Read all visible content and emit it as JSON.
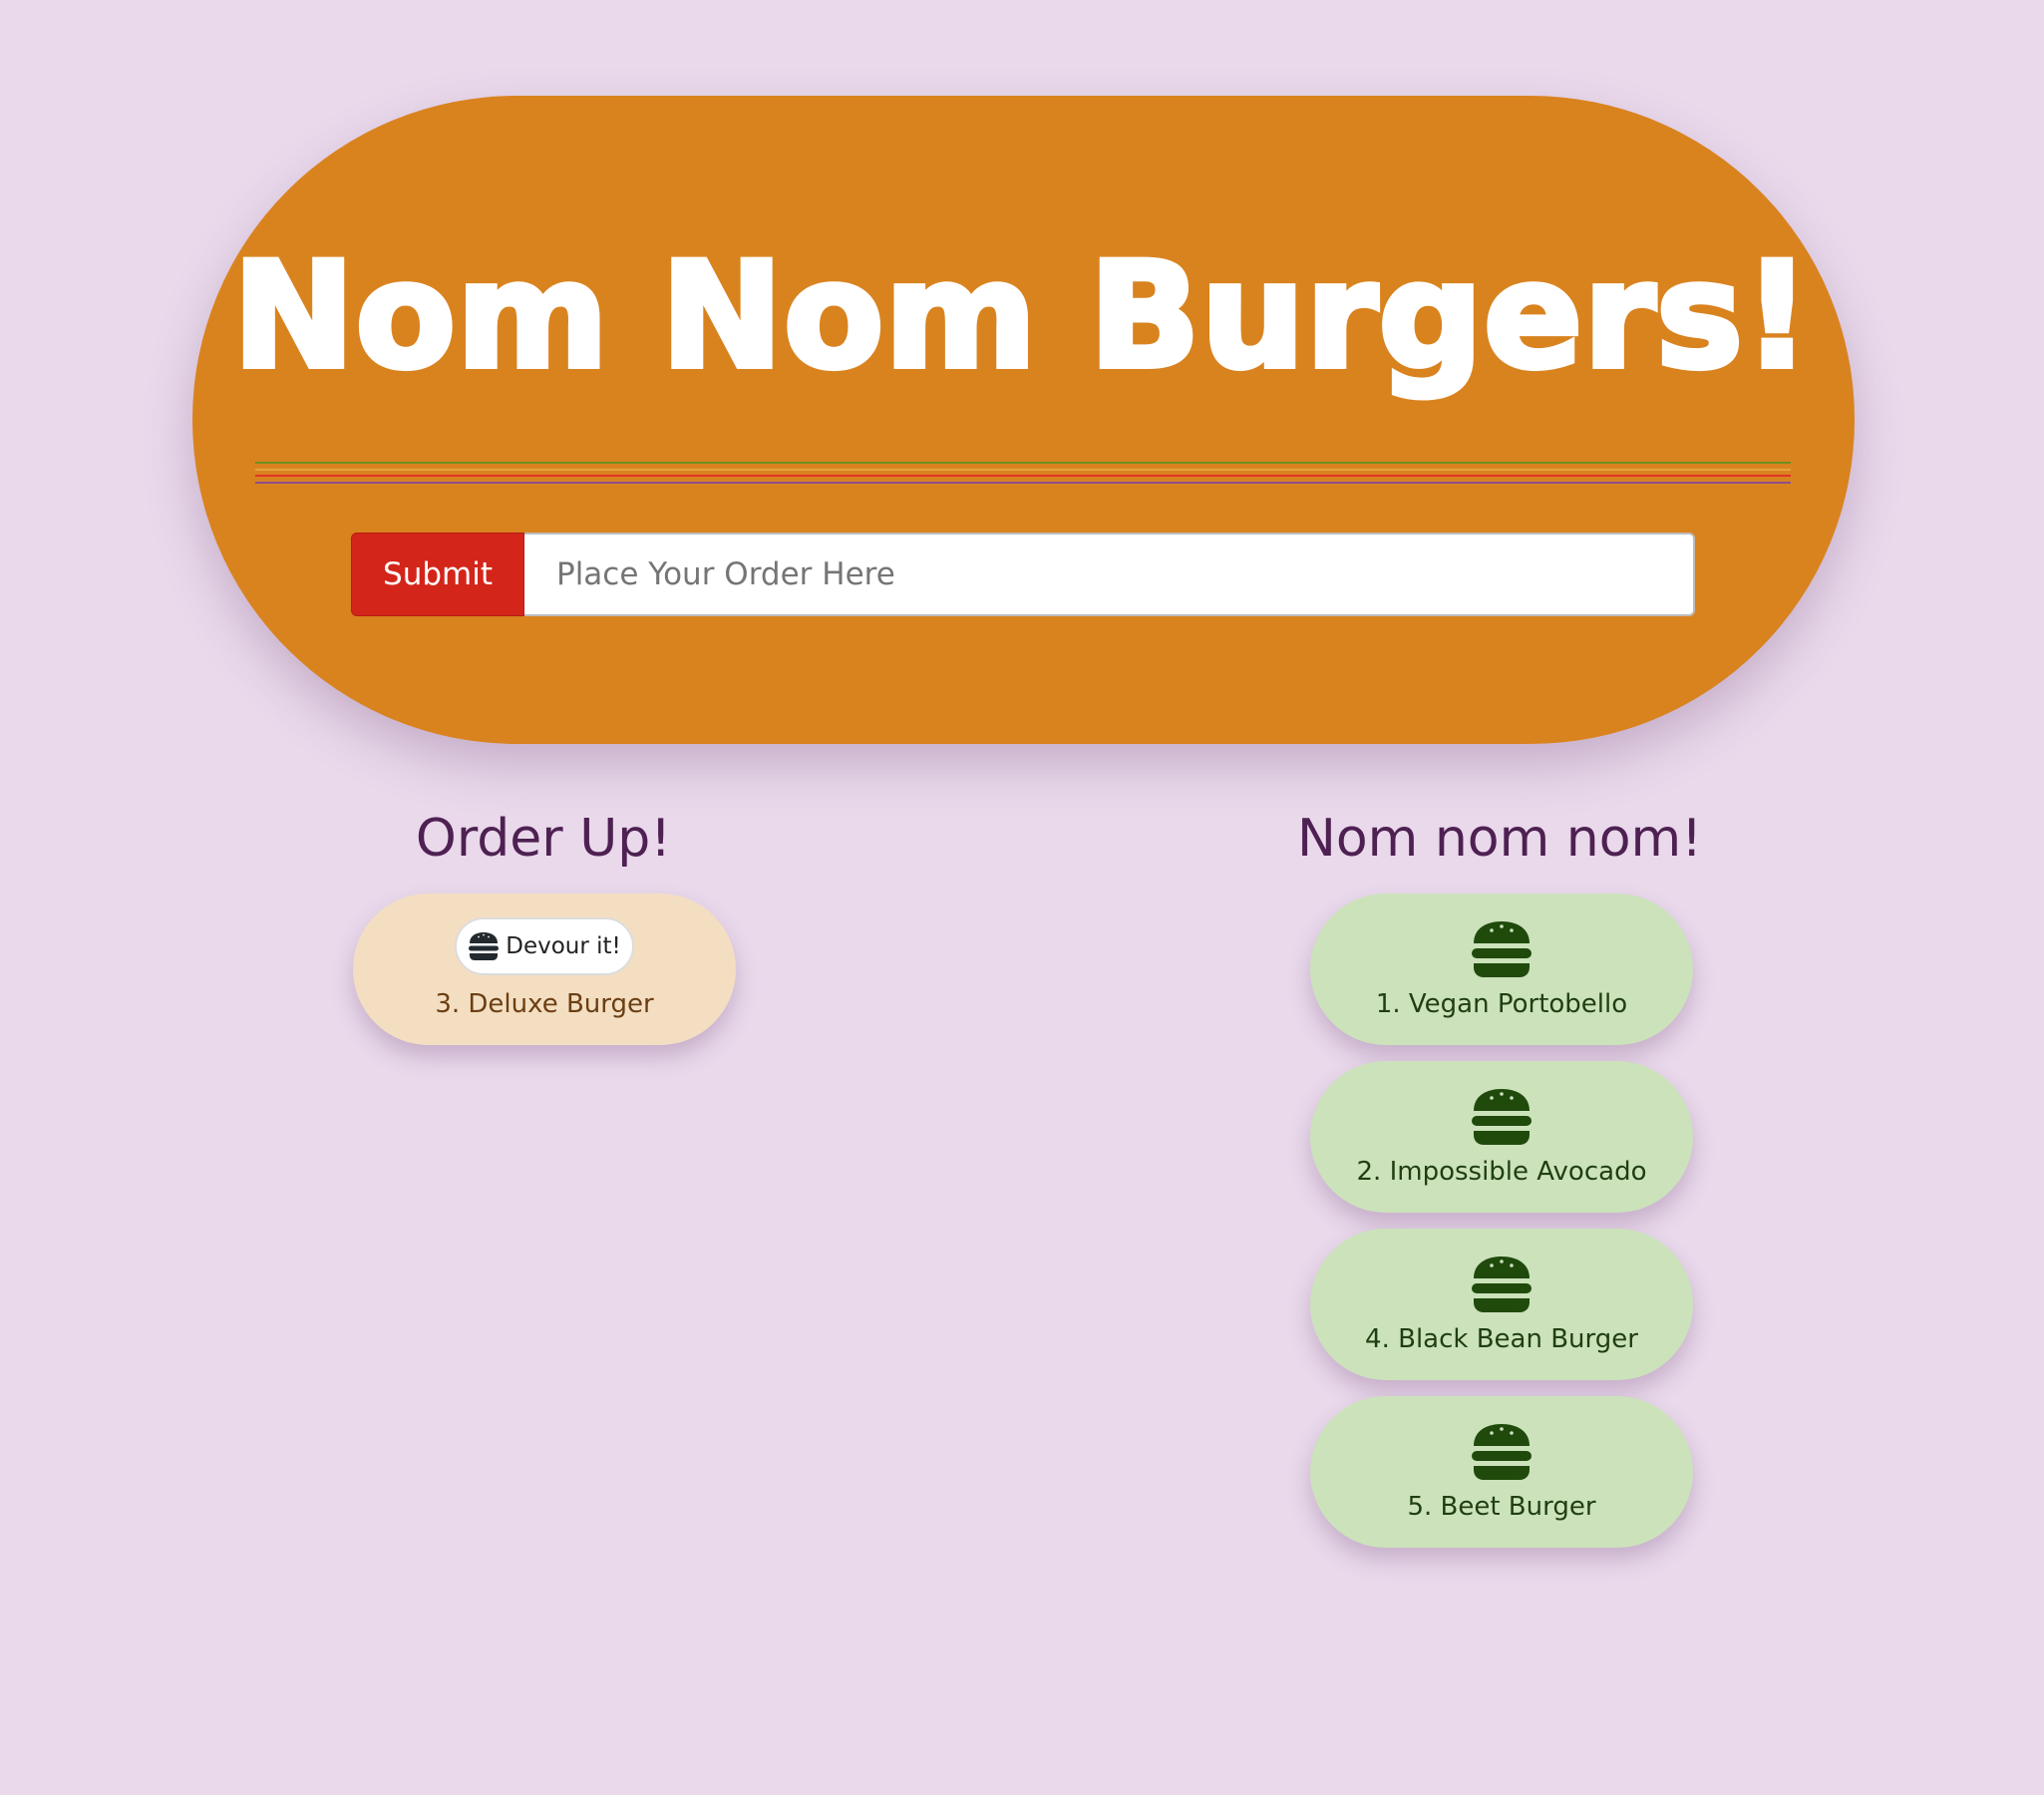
{
  "header": {
    "title": "Nom Nom Burgers!"
  },
  "order_form": {
    "submit_label": "Submit",
    "input_placeholder": "Place Your Order Here",
    "input_value": ""
  },
  "columns": {
    "waiting_title": "Order Up!",
    "devoured_title": "Nom nom nom!"
  },
  "waiting_burgers": [
    {
      "label": "3. Deluxe Burger",
      "button_label": "Devour it!",
      "icon": "burger-icon"
    }
  ],
  "devoured_burgers": [
    {
      "label": "1. Vegan Portobello",
      "icon": "burger-icon"
    },
    {
      "label": "2. Impossible Avocado",
      "icon": "burger-icon"
    },
    {
      "label": "4. Black Bean Burger",
      "icon": "burger-icon"
    },
    {
      "label": "5. Beet Burger",
      "icon": "burger-icon"
    }
  ],
  "colors": {
    "background": "#e9d9eb",
    "header": "#d9831f",
    "submit_button": "#d3251a",
    "waiting_card": "#f4dec2",
    "devoured_card": "#cce2bb",
    "column_title": "#4e2152",
    "stripe_1": "#6f8f1f",
    "stripe_2": "#e5a23b",
    "stripe_3": "#e2332a",
    "stripe_4": "#8a4e8e"
  }
}
